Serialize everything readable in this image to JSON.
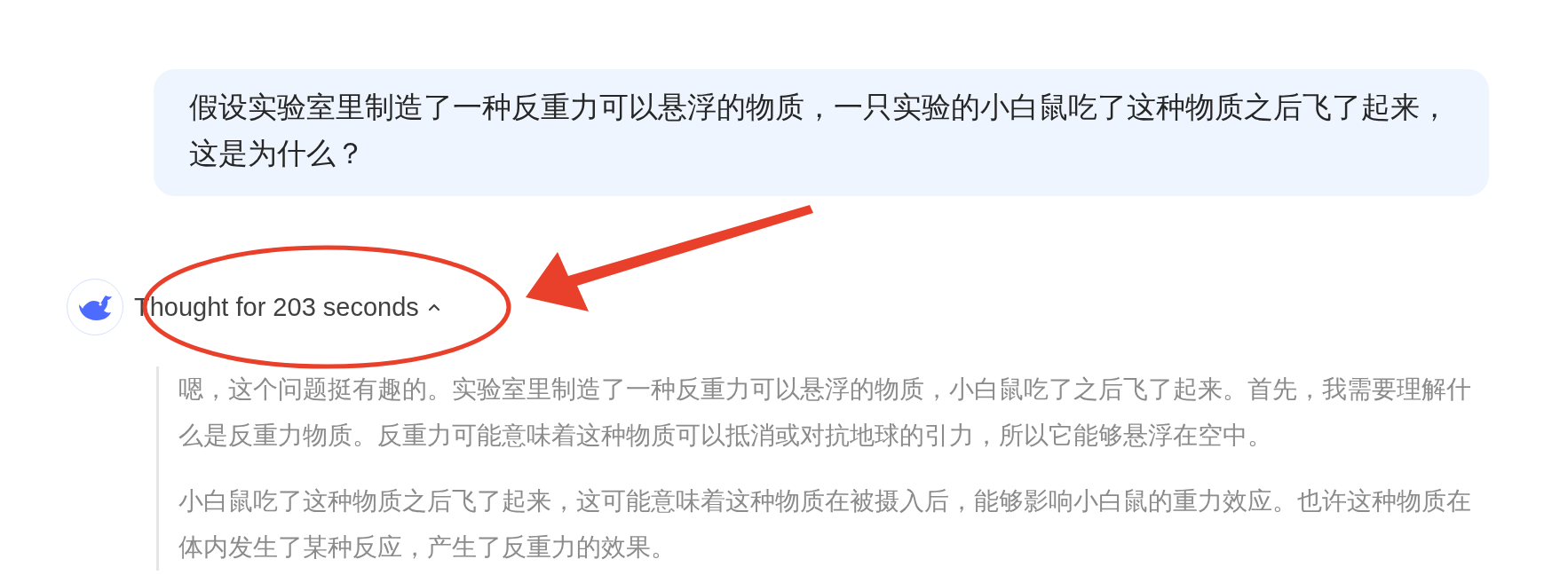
{
  "user_message": {
    "text": "假设实验室里制造了一种反重力可以悬浮的物质，一只实验的小白鼠吃了这种物质之后飞了起来，这是为什么？"
  },
  "assistant": {
    "thinking": {
      "label": "Thought for 203 seconds",
      "expanded": true,
      "paragraphs": [
        "嗯，这个问题挺有趣的。实验室里制造了一种反重力可以悬浮的物质，小白鼠吃了之后飞了起来。首先，我需要理解什么是反重力物质。反重力可能意味着这种物质可以抵消或对抗地球的引力，所以它能够悬浮在空中。",
        "小白鼠吃了这种物质之后飞了起来，这可能意味着这种物质在被摄入后，能够影响小白鼠的重力效应。也许这种物质在体内发生了某种反应，产生了反重力的效果。"
      ]
    }
  },
  "annotations": [
    {
      "kind": "ellipse"
    },
    {
      "kind": "arrow"
    }
  ]
}
